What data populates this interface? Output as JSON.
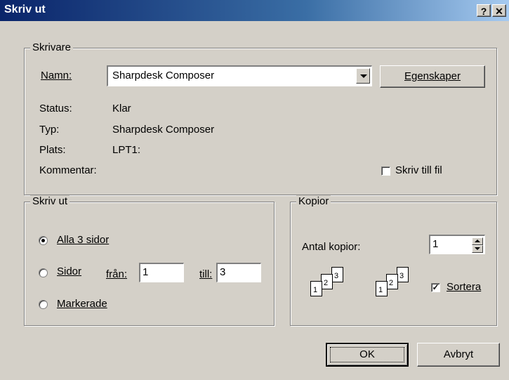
{
  "window": {
    "title": "Skriv ut",
    "help_label": "?",
    "close_label": "✕"
  },
  "printer": {
    "group_label": "Skrivare",
    "name_label": "Namn:",
    "name_value": "Sharpdesk Composer",
    "properties_button": "Egenskaper",
    "status_label": "Status:",
    "status_value": "Klar",
    "type_label": "Typ:",
    "type_value": "Sharpdesk Composer",
    "location_label": "Plats:",
    "location_value": "LPT1:",
    "comment_label": "Kommentar:",
    "print_to_file_label": "Skriv till fil",
    "print_to_file_checked": false
  },
  "range": {
    "group_label": "Skriv ut",
    "all_label": "Alla 3 sidor",
    "pages_label": "Sidor",
    "from_label": "från:",
    "from_value": "1",
    "to_label": "till:",
    "to_value": "3",
    "selection_label": "Markerade",
    "selected": "all"
  },
  "copies": {
    "group_label": "Kopior",
    "count_label": "Antal kopior:",
    "count_value": "1",
    "collate_label": "Sortera",
    "collate_checked": true,
    "collate_page_numbers": [
      "1",
      "2",
      "3"
    ]
  },
  "buttons": {
    "ok": "OK",
    "cancel": "Avbryt"
  }
}
